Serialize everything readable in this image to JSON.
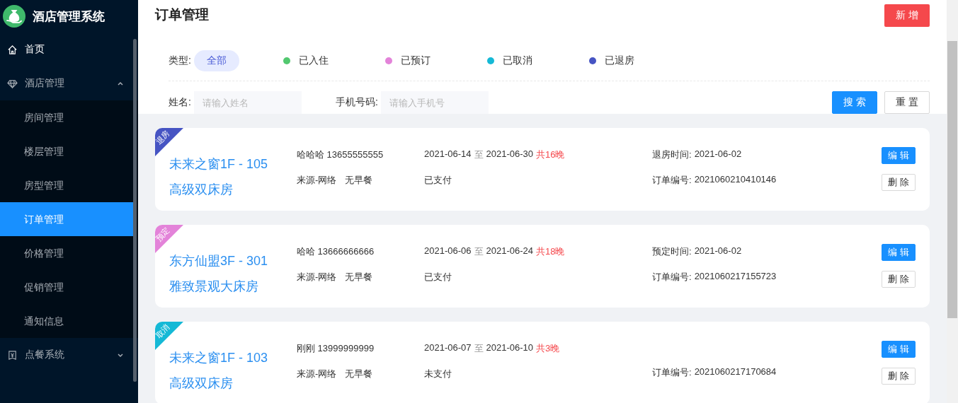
{
  "sidebar": {
    "title": "酒店管理系统",
    "items": [
      {
        "label": "首页",
        "selected": false
      },
      {
        "label": "酒店管理",
        "expanded": true,
        "selected": false,
        "children": [
          {
            "label": "房间管理",
            "selected": false
          },
          {
            "label": "楼层管理",
            "selected": false
          },
          {
            "label": "房型管理",
            "selected": false
          },
          {
            "label": "订单管理",
            "selected": true
          },
          {
            "label": "价格管理",
            "selected": false
          },
          {
            "label": "促销管理",
            "selected": false
          },
          {
            "label": "通知信息",
            "selected": false
          }
        ]
      },
      {
        "label": "点餐系统",
        "expanded": false,
        "selected": false
      }
    ]
  },
  "page_title": "订单管理",
  "add_button": "新 增",
  "type_filter": {
    "label": "类型:",
    "options": [
      {
        "label": "全部",
        "selected": true
      },
      {
        "label": "已入住",
        "color": "#52c86f",
        "selected": false
      },
      {
        "label": "已预订",
        "color": "#e383d9",
        "selected": false
      },
      {
        "label": "已取消",
        "color": "#15b9d6",
        "selected": false
      },
      {
        "label": "已退房",
        "color": "#4654c3",
        "selected": false
      }
    ]
  },
  "search": {
    "fields": [
      {
        "label": "姓名:",
        "placeholder": "请输入姓名"
      },
      {
        "label": "手机号码:",
        "placeholder": "请输入手机号"
      }
    ],
    "buttons": [
      {
        "label": "搜 索",
        "kind": "primary"
      },
      {
        "label": "重 置",
        "kind": "default"
      }
    ]
  },
  "orders": [
    {
      "tag": "退房",
      "color": "#4654c3",
      "room": "未来之窗1F - 105",
      "room_type": "高级双床房",
      "guest": "哈哈哈 13655555555",
      "source": "来源-网络",
      "breakfast": "无早餐",
      "check_in": "2021-06-14",
      "range_sep": "至",
      "check_out": "2021-06-30",
      "nights": "共16晚",
      "payment": "已支付",
      "date_label": "退房时间:",
      "date_value": "2021-06-02",
      "order_label": "订单编号:",
      "order_no": "2021060210410146",
      "buttons": [
        {
          "label": "编 辑",
          "kind": "primary"
        },
        {
          "label": "删 除",
          "kind": "default"
        }
      ]
    },
    {
      "tag": "预定",
      "color": "#e383d9",
      "room": "东方仙盟3F - 301",
      "room_type": "雅致景观大床房",
      "guest": "哈哈 13666666666",
      "source": "来源-网络",
      "breakfast": "无早餐",
      "check_in": "2021-06-06",
      "range_sep": "至",
      "check_out": "2021-06-24",
      "nights": "共18晚",
      "payment": "已支付",
      "date_label": "预定时间:",
      "date_value": "2021-06-02",
      "order_label": "订单编号:",
      "order_no": "2021060217155723",
      "buttons": [
        {
          "label": "编 辑",
          "kind": "primary"
        },
        {
          "label": "删 除",
          "kind": "default"
        }
      ]
    },
    {
      "tag": "取消",
      "color": "#15b9d6",
      "room": "未来之窗1F - 103",
      "room_type": "高级双床房",
      "guest": "刚刚 13999999999",
      "source": "来源-网络",
      "breakfast": "无早餐",
      "check_in": "2021-06-07",
      "range_sep": "至",
      "check_out": "2021-06-10",
      "nights": "共3晚",
      "payment": "未支付",
      "order_label": "订单编号:",
      "order_no": "2021060217170684",
      "buttons": [
        {
          "label": "编 辑",
          "kind": "primary"
        },
        {
          "label": "删 除",
          "kind": "default"
        }
      ]
    }
  ]
}
